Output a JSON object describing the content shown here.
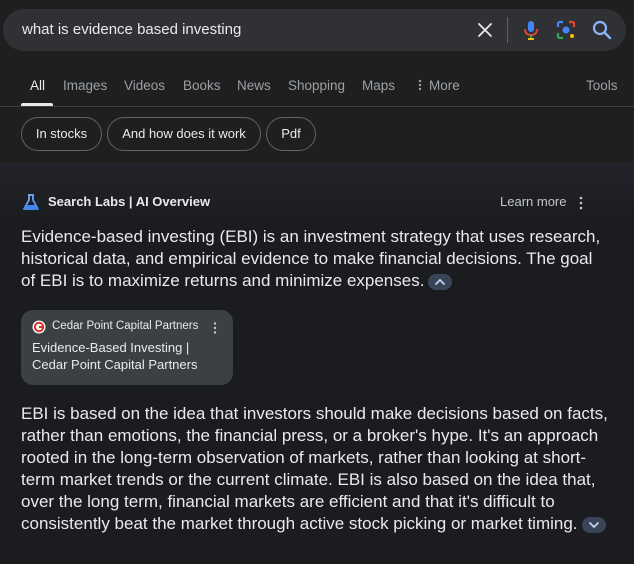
{
  "search": {
    "query": "what is evidence based investing"
  },
  "tabs": [
    {
      "label": "All"
    },
    {
      "label": "Images"
    },
    {
      "label": "Videos"
    },
    {
      "label": "Books"
    },
    {
      "label": "News"
    },
    {
      "label": "Shopping"
    },
    {
      "label": "Maps"
    },
    {
      "label": "More"
    }
  ],
  "tools_label": "Tools",
  "chips": [
    {
      "label": "In stocks"
    },
    {
      "label": "And how does it work"
    },
    {
      "label": "Pdf"
    }
  ],
  "ai_overview": {
    "title": "Search Labs | AI Overview",
    "learn_more": "Learn more",
    "paragraph1": "Evidence-based investing (EBI) is an investment strategy that uses research, historical data, and empirical evidence to make financial decisions. The goal of EBI is to maximize returns and minimize expenses.",
    "source": {
      "site": "Cedar Point Capital Partners",
      "title": "Evidence-Based Investing | Cedar Point Capital Partners"
    },
    "paragraph2": "EBI is based on the idea that investors should make decisions based on facts, rather than emotions, the financial press, or a broker's hype. It's an approach rooted in the long-term observation of markets, rather than looking at short-term market trends or the current climate. EBI is also based on the idea that, over the long term, financial markets are efficient and that it's difficult to consistently beat the market through active stock picking or market timing."
  },
  "colors": {
    "background": "#1f1f1f",
    "searchbox": "#303134",
    "accent_chip": "#394457",
    "source_card": "#3c4043"
  },
  "icons": [
    "clear-icon",
    "mic-icon",
    "lens-icon",
    "search-icon",
    "labs-icon",
    "kebab-icon",
    "favicon",
    "chevron-up-icon",
    "chevron-down-icon"
  ]
}
